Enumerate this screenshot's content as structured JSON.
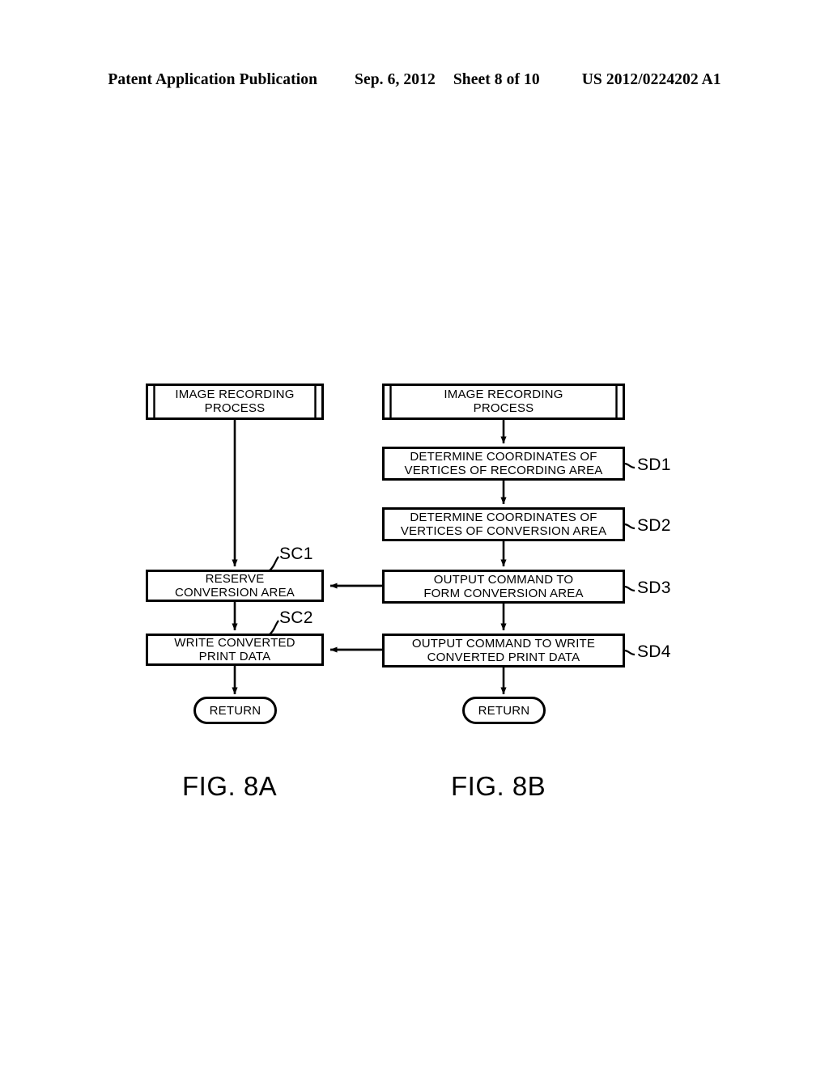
{
  "header": {
    "publication": "Patent Application Publication",
    "date": "Sep. 6, 2012",
    "sheet": "Sheet 8 of 10",
    "number": "US 2012/0224202 A1"
  },
  "figures": [
    {
      "caption": "FIG. 8A",
      "nodes": [
        {
          "id": "a-start",
          "type": "subroutine",
          "text": "IMAGE RECORDING\nPROCESS"
        },
        {
          "id": "a-sc1",
          "type": "process",
          "text": "RESERVE\nCONVERSION AREA",
          "ref": "SC1"
        },
        {
          "id": "a-sc2",
          "type": "process",
          "text": "WRITE CONVERTED\nPRINT DATA",
          "ref": "SC2"
        },
        {
          "id": "a-return",
          "type": "terminator",
          "text": "RETURN"
        }
      ]
    },
    {
      "caption": "FIG. 8B",
      "nodes": [
        {
          "id": "b-start",
          "type": "subroutine",
          "text": "IMAGE RECORDING\nPROCESS"
        },
        {
          "id": "b-sd1",
          "type": "process",
          "text": "DETERMINE COORDINATES OF\nVERTICES OF RECORDING AREA",
          "ref": "SD1"
        },
        {
          "id": "b-sd2",
          "type": "process",
          "text": "DETERMINE COORDINATES OF\nVERTICES OF CONVERSION AREA",
          "ref": "SD2"
        },
        {
          "id": "b-sd3",
          "type": "process",
          "text": "OUTPUT COMMAND TO\nFORM CONVERSION AREA",
          "ref": "SD3"
        },
        {
          "id": "b-sd4",
          "type": "process",
          "text": "OUTPUT COMMAND TO WRITE\nCONVERTED PRINT DATA",
          "ref": "SD4"
        },
        {
          "id": "b-return",
          "type": "terminator",
          "text": "RETURN"
        }
      ]
    }
  ],
  "style": {
    "stroke": "#000000",
    "fill": "#ffffff"
  }
}
